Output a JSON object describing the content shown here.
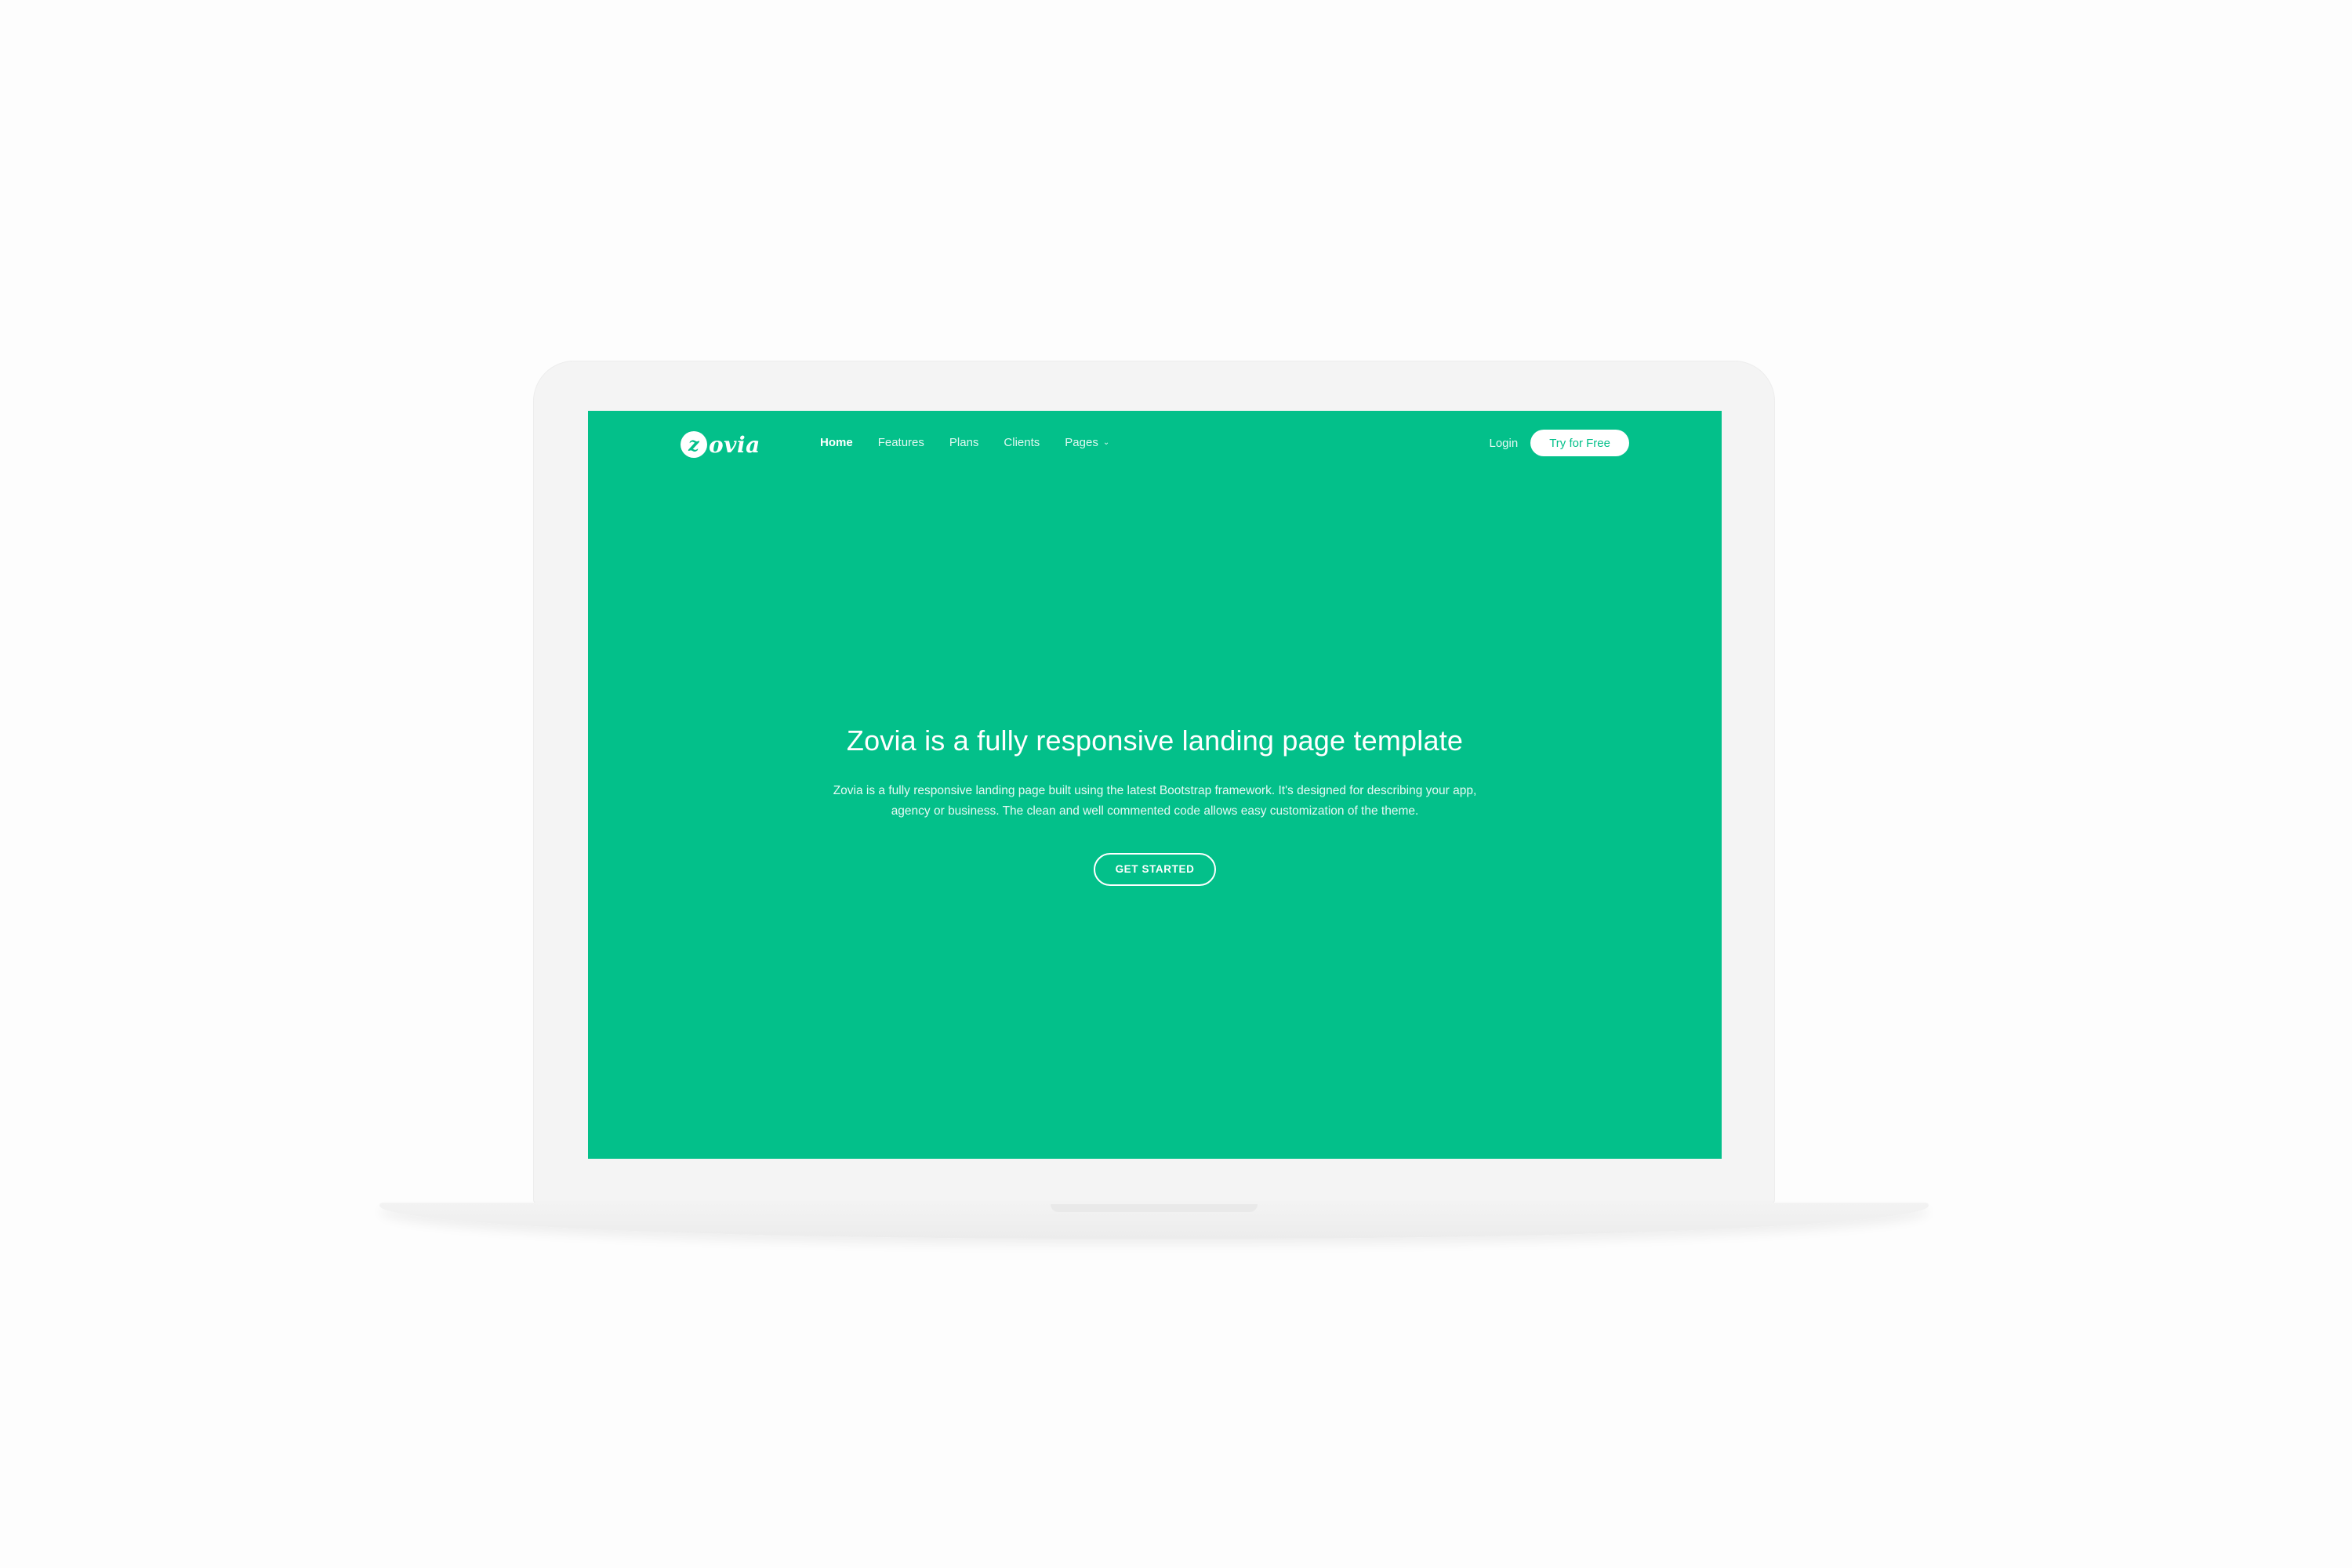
{
  "brand": {
    "logo_letter": "z",
    "logo_rest": "ovia"
  },
  "nav": {
    "items": [
      {
        "label": "Home",
        "active": true
      },
      {
        "label": "Features"
      },
      {
        "label": "Plans"
      },
      {
        "label": "Clients"
      },
      {
        "label": "Pages",
        "icon": "chevron-down-icon"
      }
    ],
    "login_label": "Login",
    "cta_label": "Try for Free"
  },
  "hero": {
    "title": "Zovia is a fully responsive landing page template",
    "description_line1": "Zovia is a fully responsive landing page built using the latest Bootstrap framework. It's designed for describing your app,",
    "description_line2": "agency or business. The clean and well commented code allows easy customization of the theme.",
    "cta_label": "GET STARTED"
  },
  "colors": {
    "brand_green": "#03c08a",
    "white": "#ffffff"
  }
}
